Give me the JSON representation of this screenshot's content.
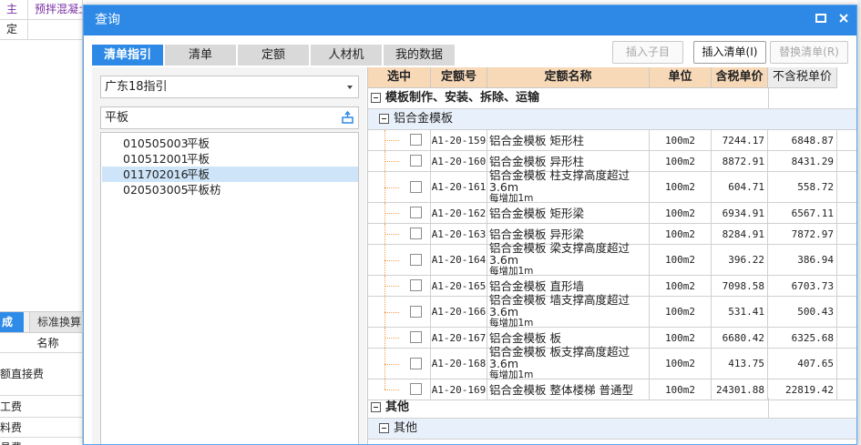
{
  "background": {
    "top_rows": [
      {
        "cell1": "主",
        "cell2": "预拌混凝土"
      },
      {
        "cell1": "定",
        "cell2": ""
      }
    ],
    "tabs": [
      {
        "label": "成"
      },
      {
        "label": "标准换算"
      }
    ],
    "list_header": "名称",
    "list_items": [
      {
        "label": "额直接费"
      },
      {
        "label": "工费"
      },
      {
        "label": "料费"
      },
      {
        "label": "具费"
      }
    ]
  },
  "dialog": {
    "title": "查询",
    "tabs": [
      {
        "label": "清单指引",
        "active": true
      },
      {
        "label": "清单"
      },
      {
        "label": "定额"
      },
      {
        "label": "人材机"
      },
      {
        "label": "我的数据"
      }
    ],
    "buttons": {
      "insert_child": "插入子目",
      "insert_list": "插入清单(I)",
      "replace_list": "替换清单(R)"
    },
    "guide_select": {
      "value": "广东18指引"
    },
    "search": {
      "value": "平板"
    },
    "results": [
      {
        "code": "010505003",
        "name": "平板",
        "selected": false
      },
      {
        "code": "010512001",
        "name": "平板",
        "selected": false
      },
      {
        "code": "011702016",
        "name": "平板",
        "selected": true
      },
      {
        "code": "020503005",
        "name": "平板枋",
        "selected": false
      }
    ],
    "grid": {
      "columns": {
        "select": "选中",
        "code": "定额号",
        "name": "定额名称",
        "unit": "单位",
        "price_tax": "含税单价",
        "price_notax": "不含税单价"
      },
      "group1": "模板制作、安装、拆除、运输",
      "subgroup1": "铝合金模板",
      "rows": [
        {
          "code": "A1-20-159",
          "name_main": "铝合金模板 矩形柱",
          "name_sub": "",
          "unit": "100m2",
          "price_tax": "7244.17",
          "price_notax": "6848.87"
        },
        {
          "code": "A1-20-160",
          "name_main": "铝合金模板 异形柱",
          "name_sub": "",
          "unit": "100m2",
          "price_tax": "8872.91",
          "price_notax": "8431.29"
        },
        {
          "code": "A1-20-161",
          "name_main": "铝合金模板 柱支撑高度超过3.6m",
          "name_sub": "每增加1m",
          "unit": "100m2",
          "price_tax": "604.71",
          "price_notax": "558.72"
        },
        {
          "code": "A1-20-162",
          "name_main": "铝合金模板 矩形梁",
          "name_sub": "",
          "unit": "100m2",
          "price_tax": "6934.91",
          "price_notax": "6567.11"
        },
        {
          "code": "A1-20-163",
          "name_main": "铝合金模板 异形梁",
          "name_sub": "",
          "unit": "100m2",
          "price_tax": "8284.91",
          "price_notax": "7872.97"
        },
        {
          "code": "A1-20-164",
          "name_main": "铝合金模板 梁支撑高度超过3.6m",
          "name_sub": "每增加1m",
          "unit": "100m2",
          "price_tax": "396.22",
          "price_notax": "386.94"
        },
        {
          "code": "A1-20-165",
          "name_main": "铝合金模板 直形墙",
          "name_sub": "",
          "unit": "100m2",
          "price_tax": "7098.58",
          "price_notax": "6703.73"
        },
        {
          "code": "A1-20-166",
          "name_main": "铝合金模板 墙支撑高度超过3.6m",
          "name_sub": "每增加1m",
          "unit": "100m2",
          "price_tax": "531.41",
          "price_notax": "500.43"
        },
        {
          "code": "A1-20-167",
          "name_main": "铝合金模板 板",
          "name_sub": "",
          "unit": "100m2",
          "price_tax": "6680.42",
          "price_notax": "6325.68"
        },
        {
          "code": "A1-20-168",
          "name_main": "铝合金模板 板支撑高度超过3.6m",
          "name_sub": "每增加1m",
          "unit": "100m2",
          "price_tax": "413.75",
          "price_notax": "407.65"
        },
        {
          "code": "A1-20-169",
          "name_main": "铝合金模板 整体楼梯 普通型",
          "name_sub": "",
          "unit": "100m2",
          "price_tax": "24301.88",
          "price_notax": "22819.42"
        }
      ],
      "group2": "其他",
      "subgroup2": "其他"
    }
  },
  "colors": {
    "accent": "#2d89e5",
    "header_bg": "#f7d9b8",
    "selected_row": "#cde4f9"
  }
}
